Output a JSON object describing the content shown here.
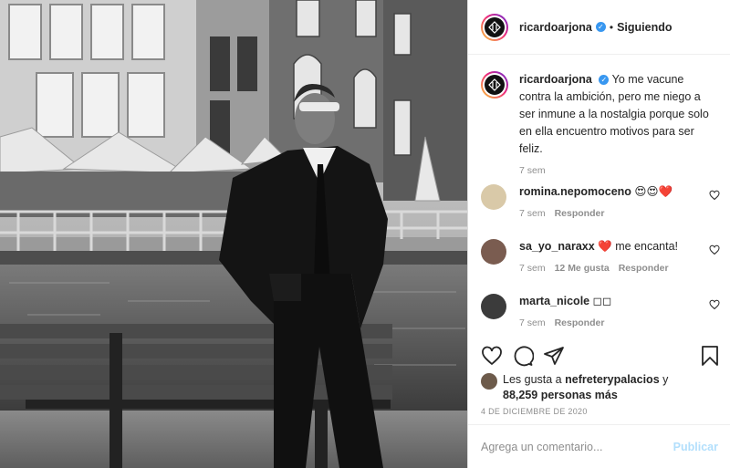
{
  "header": {
    "username": "ricardoarjona",
    "separator": "•",
    "follow_status": "Siguiendo"
  },
  "caption": {
    "username": "ricardoarjona",
    "text": "Yo me vacune contra la ambición, pero me niego a ser inmune a la nostalgia porque solo en ella encuentro motivos para ser feliz.",
    "time": "7 sem"
  },
  "comments": [
    {
      "username": "romina.nepomoceno",
      "text": "😍😍❤️",
      "time": "7 sem",
      "likes": "",
      "reply": "Responder"
    },
    {
      "username": "sa_yo_naraxx",
      "text": "❤️ me encanta!",
      "time": "7 sem",
      "likes": "12 Me gusta",
      "reply": "Responder"
    },
    {
      "username": "marta_nicole",
      "text": "◻◻",
      "time": "7 sem",
      "likes": "",
      "reply": "Responder"
    }
  ],
  "likes": {
    "prefix": "Les gusta a",
    "user": "nefreterypalacios",
    "connector": "y",
    "others": "88,259 personas más"
  },
  "date": "4 DE DICIEMBRE DE 2020",
  "comment_box": {
    "placeholder": "Agrega un comentario...",
    "publish": "Publicar"
  },
  "icons": {
    "verified": "verified-badge-icon",
    "like": "heart-icon",
    "comment": "comment-bubble-icon",
    "share": "paper-plane-icon",
    "save": "bookmark-icon"
  },
  "colors": {
    "verified_blue": "#3897f0",
    "publish_disabled": "#b2dffc",
    "meta_gray": "#8e8e8e",
    "text": "#262626"
  }
}
